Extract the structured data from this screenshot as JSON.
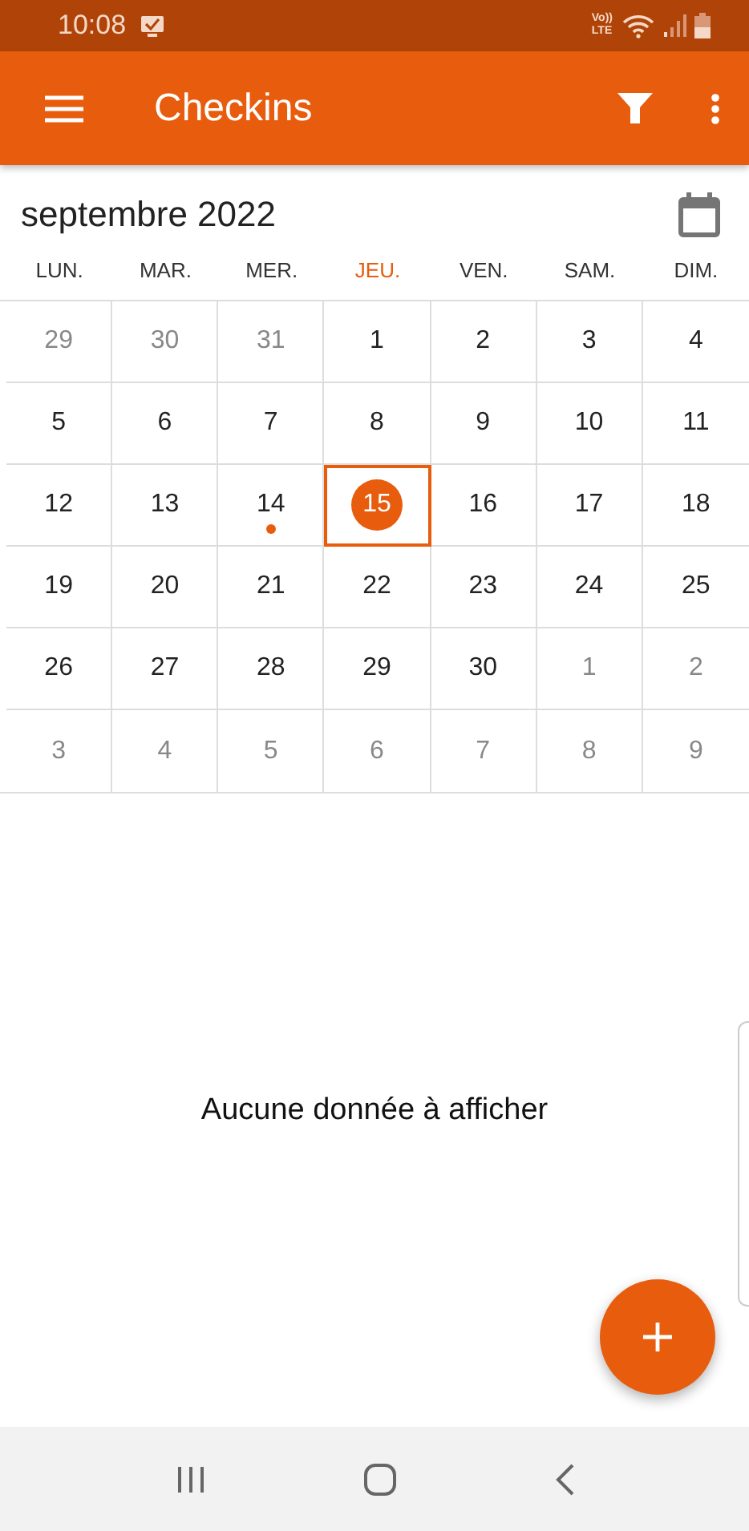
{
  "status_bar": {
    "time": "10:08",
    "network_top": "Vo))",
    "network_bottom": "LTE"
  },
  "app_bar": {
    "title": "Checkins"
  },
  "calendar": {
    "month": "septembre 2022",
    "weekdays": [
      {
        "label": "LUN.",
        "selected": false
      },
      {
        "label": "MAR.",
        "selected": false
      },
      {
        "label": "MER.",
        "selected": false
      },
      {
        "label": "JEU.",
        "selected": true
      },
      {
        "label": "VEN.",
        "selected": false
      },
      {
        "label": "SAM.",
        "selected": false
      },
      {
        "label": "DIM.",
        "selected": false
      }
    ],
    "weeks": [
      [
        {
          "day": "29",
          "outside": true,
          "selected": false,
          "has_event": false
        },
        {
          "day": "30",
          "outside": true,
          "selected": false,
          "has_event": false
        },
        {
          "day": "31",
          "outside": true,
          "selected": false,
          "has_event": false
        },
        {
          "day": "1",
          "outside": false,
          "selected": false,
          "has_event": false
        },
        {
          "day": "2",
          "outside": false,
          "selected": false,
          "has_event": false
        },
        {
          "day": "3",
          "outside": false,
          "selected": false,
          "has_event": false
        },
        {
          "day": "4",
          "outside": false,
          "selected": false,
          "has_event": false
        }
      ],
      [
        {
          "day": "5",
          "outside": false,
          "selected": false,
          "has_event": false
        },
        {
          "day": "6",
          "outside": false,
          "selected": false,
          "has_event": false
        },
        {
          "day": "7",
          "outside": false,
          "selected": false,
          "has_event": false
        },
        {
          "day": "8",
          "outside": false,
          "selected": false,
          "has_event": false
        },
        {
          "day": "9",
          "outside": false,
          "selected": false,
          "has_event": false
        },
        {
          "day": "10",
          "outside": false,
          "selected": false,
          "has_event": false
        },
        {
          "day": "11",
          "outside": false,
          "selected": false,
          "has_event": false
        }
      ],
      [
        {
          "day": "12",
          "outside": false,
          "selected": false,
          "has_event": false
        },
        {
          "day": "13",
          "outside": false,
          "selected": false,
          "has_event": false
        },
        {
          "day": "14",
          "outside": false,
          "selected": false,
          "has_event": true
        },
        {
          "day": "15",
          "outside": false,
          "selected": true,
          "has_event": false
        },
        {
          "day": "16",
          "outside": false,
          "selected": false,
          "has_event": false
        },
        {
          "day": "17",
          "outside": false,
          "selected": false,
          "has_event": false
        },
        {
          "day": "18",
          "outside": false,
          "selected": false,
          "has_event": false
        }
      ],
      [
        {
          "day": "19",
          "outside": false,
          "selected": false,
          "has_event": false
        },
        {
          "day": "20",
          "outside": false,
          "selected": false,
          "has_event": false
        },
        {
          "day": "21",
          "outside": false,
          "selected": false,
          "has_event": false
        },
        {
          "day": "22",
          "outside": false,
          "selected": false,
          "has_event": false
        },
        {
          "day": "23",
          "outside": false,
          "selected": false,
          "has_event": false
        },
        {
          "day": "24",
          "outside": false,
          "selected": false,
          "has_event": false
        },
        {
          "day": "25",
          "outside": false,
          "selected": false,
          "has_event": false
        }
      ],
      [
        {
          "day": "26",
          "outside": false,
          "selected": false,
          "has_event": false
        },
        {
          "day": "27",
          "outside": false,
          "selected": false,
          "has_event": false
        },
        {
          "day": "28",
          "outside": false,
          "selected": false,
          "has_event": false
        },
        {
          "day": "29",
          "outside": false,
          "selected": false,
          "has_event": false
        },
        {
          "day": "30",
          "outside": false,
          "selected": false,
          "has_event": false
        },
        {
          "day": "1",
          "outside": true,
          "selected": false,
          "has_event": false
        },
        {
          "day": "2",
          "outside": true,
          "selected": false,
          "has_event": false
        }
      ],
      [
        {
          "day": "3",
          "outside": true,
          "selected": false,
          "has_event": false
        },
        {
          "day": "4",
          "outside": true,
          "selected": false,
          "has_event": false
        },
        {
          "day": "5",
          "outside": true,
          "selected": false,
          "has_event": false
        },
        {
          "day": "6",
          "outside": true,
          "selected": false,
          "has_event": false
        },
        {
          "day": "7",
          "outside": true,
          "selected": false,
          "has_event": false
        },
        {
          "day": "8",
          "outside": true,
          "selected": false,
          "has_event": false
        },
        {
          "day": "9",
          "outside": true,
          "selected": false,
          "has_event": false
        }
      ]
    ]
  },
  "empty_message": "Aucune donnée à afficher"
}
